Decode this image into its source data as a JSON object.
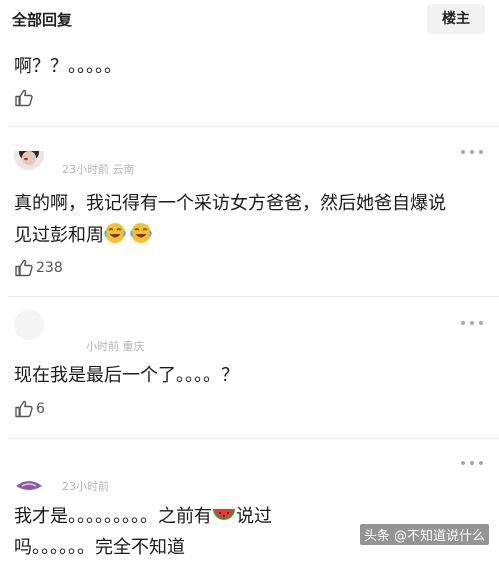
{
  "header": {
    "title": "全部回复",
    "op_button": "楼主"
  },
  "comments": [
    {
      "text_lines": [
        "啊？？。。。。。"
      ],
      "like_count": ""
    },
    {
      "meta": "23小时前 云南",
      "text_line1": "真的啊，我记得有一个采访女方爸爸，然后她爸自爆说",
      "text_line2": "见过彭和周",
      "emoji_names": [
        "laugh-cry-emoji",
        "laugh-cry-emoji"
      ],
      "like_count": "238"
    },
    {
      "meta": "小时前 重庆",
      "text_line1": "现在我是最后一个了。。。。？",
      "like_count": "6"
    },
    {
      "meta": "23小时前",
      "text_line1a": "我才是。。。。。。。。。之前有",
      "emoji_name": "watermelon-emoji",
      "text_line1b": "说过",
      "text_line2": "吗。。。。。。完全不知道"
    }
  ],
  "watermark": "头条 @不知道说什么"
}
